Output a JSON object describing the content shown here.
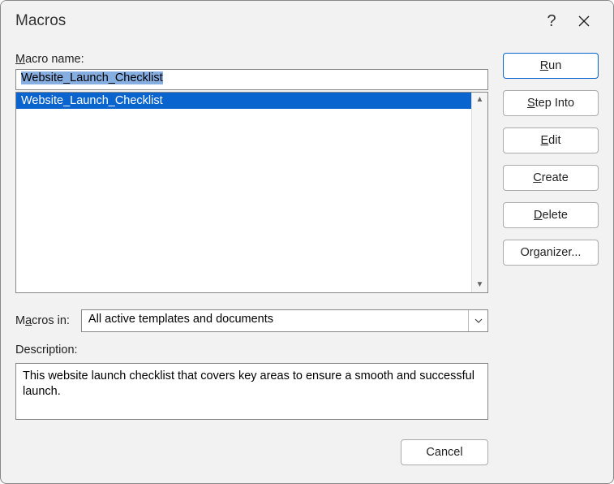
{
  "titlebar": {
    "title": "Macros",
    "help": "?"
  },
  "labels": {
    "macro_name_pre": "M",
    "macro_name_post": "acro name:",
    "macros_in_pre": "M",
    "macros_in_mid": "a",
    "macros_in_post": "cros in:",
    "description": "Description:"
  },
  "macro_name_value": "Website_Launch_Checklist",
  "macro_list": {
    "items": [
      "Website_Launch_Checklist"
    ],
    "selected_index": 0
  },
  "macros_in": {
    "selected": "All active templates and documents"
  },
  "description_text": "This website launch checklist that covers key areas to ensure a smooth and successful launch.",
  "buttons": {
    "run_u": "R",
    "run_rest": "un",
    "step_u": "S",
    "step_rest": "tep Into",
    "edit_u": "E",
    "edit_rest": "dit",
    "create_u": "C",
    "create_rest": "reate",
    "delete_u": "D",
    "delete_rest": "elete",
    "organizer": "Organizer...",
    "cancel": "Cancel"
  }
}
